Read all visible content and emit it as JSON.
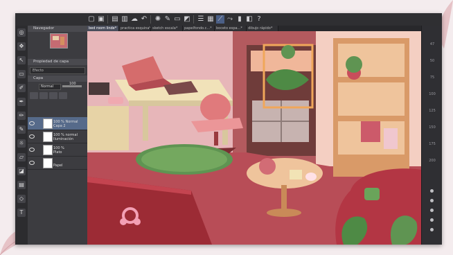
{
  "app": {
    "layers_panel_title": "Navegador",
    "properties_title": "Propiedad de capa",
    "layer_panel_label": "Capa",
    "blend_mode": "Normal",
    "opacity_value": "100",
    "layer_search_placeholder": "Efecto"
  },
  "tabs": [
    {
      "label": "bed room linde*",
      "active": true
    },
    {
      "label": "practica esquina*",
      "active": false
    },
    {
      "label": "sketch escala*",
      "active": false
    },
    {
      "label": "papelfondo.c...*",
      "active": false
    },
    {
      "label": "boceto espa...*",
      "active": false
    },
    {
      "label": "dibujo rápido*",
      "active": false
    }
  ],
  "layers": [
    {
      "title": "100 % Normal",
      "name": "Capa 2",
      "selected": true
    },
    {
      "title": "100 % normal",
      "name": "Iluminación",
      "selected": false
    },
    {
      "title": "100 %",
      "name": "Plato",
      "selected": false
    },
    {
      "title": "",
      "name": "Papel",
      "selected": false
    }
  ],
  "ruler_numbers": [
    "47",
    "50",
    "75",
    "100",
    "125",
    "150",
    "175",
    "200"
  ],
  "colors": {
    "app_bg": "#3a3a3d",
    "accent_selection": "#566a8a",
    "wall_pink": "#e7b6b9",
    "floor_red": "#b84d57",
    "wood": "#d99a68"
  }
}
